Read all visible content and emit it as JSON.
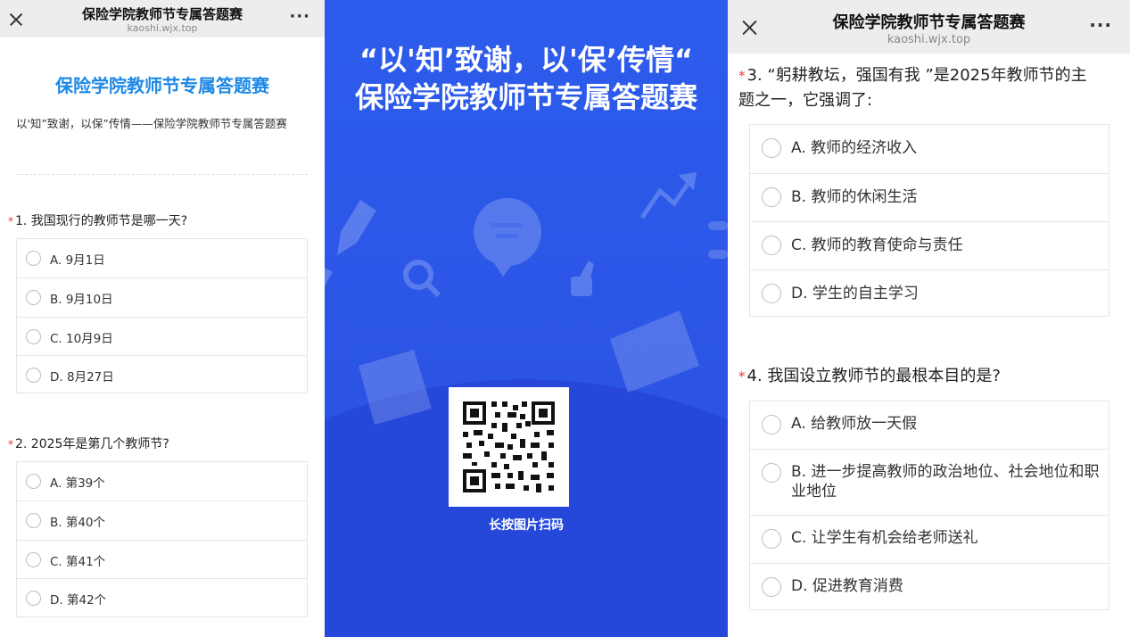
{
  "left": {
    "nav": {
      "title": "保险学院教师节专属答题赛",
      "domain": "kaoshi.wjx.top",
      "more": "···"
    },
    "survey_title": "保险学院教师节专属答题赛",
    "survey_desc": "以'知”致谢，以保”传情——保险学院教师节专属答题赛",
    "questions": [
      {
        "required": "*",
        "title": "1. 我国现行的教师节是哪一天?",
        "options": [
          "A. 9月1日",
          "B. 9月10日",
          "C. 10月9日",
          "D. 8月27日"
        ]
      },
      {
        "required": "*",
        "title": "2. 2025年是第几个教师节?",
        "options": [
          "A. 第39个",
          "B. 第40个",
          "C. 第41个",
          "D. 第42个"
        ]
      }
    ]
  },
  "middle": {
    "headline_1": "“以'知’致谢，以'保’传情“",
    "headline_2": "保险学院教师节专属答题赛",
    "qr_caption": "长按图片扫码",
    "colors": {
      "top": "#2d58ea",
      "bottom": "#2446d6"
    }
  },
  "right": {
    "nav": {
      "title": "保险学院教师节专属答题赛",
      "domain": "kaoshi.wjx.top",
      "more": "···"
    },
    "questions": [
      {
        "required": "*",
        "title": "3. “躬耕教坛，强国有我 ”是2025年教师节的主题之一，它强调了:",
        "options": [
          "A. 教师的经济收入",
          "B. 教师的休闲生活",
          "C. 教师的教育使命与责任",
          "D. 学生的自主学习"
        ]
      },
      {
        "required": "*",
        "title": "4. 我国设立教师节的最根本目的是?",
        "options": [
          "A. 给教师放一天假",
          "B. 进一步提高教师的政治地位、社会地位和职业地位",
          "C. 让学生有机会给老师送礼",
          "D. 促进教育消费"
        ]
      }
    ]
  },
  "icons": [
    "close-icon",
    "more-icon",
    "qr-code-icon",
    "pencil-icon",
    "chat-bubble-icon",
    "magnifier-icon",
    "thumbs-up-icon",
    "chart-icon",
    "clipboard-icon",
    "score-card-icon"
  ],
  "colors": {
    "accent_blue": "#1e88e5",
    "required_red": "#e53935",
    "poster_blue": "#2f5bea"
  }
}
